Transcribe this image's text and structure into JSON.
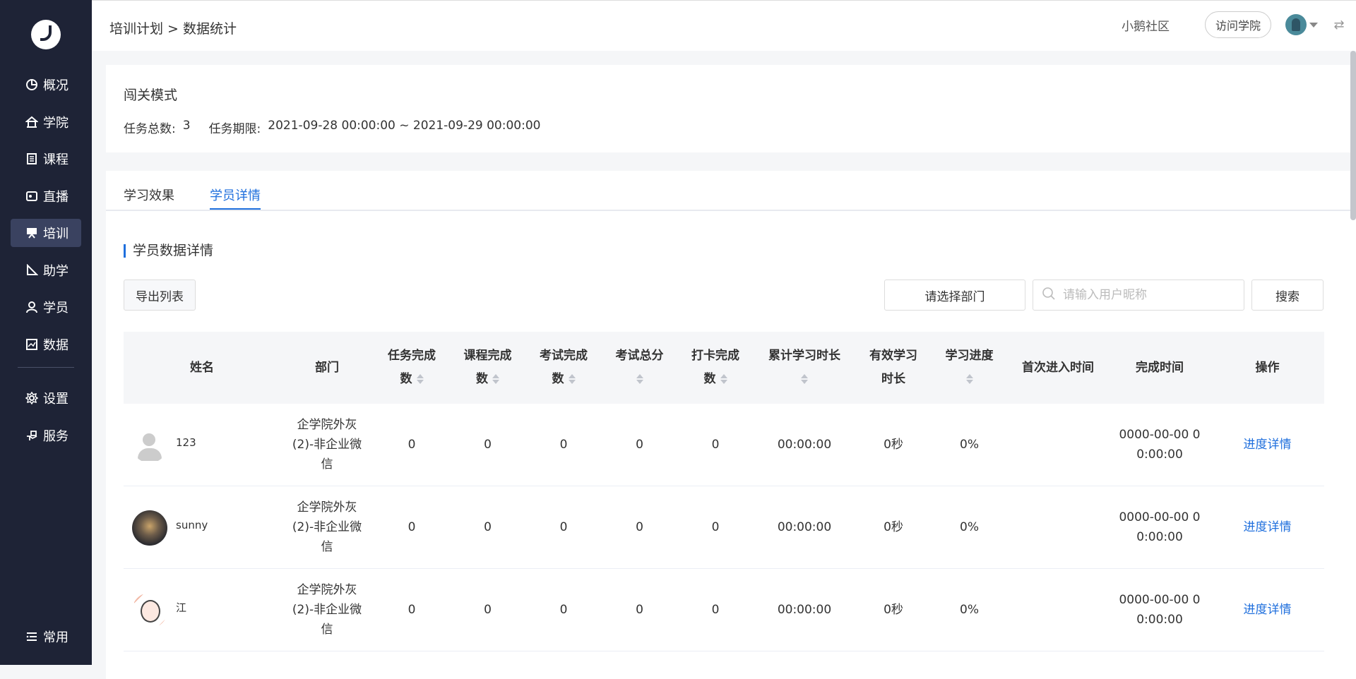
{
  "sidebar": {
    "items": [
      {
        "label": "概况",
        "icon": "pie-chart-icon"
      },
      {
        "label": "学院",
        "icon": "college-icon"
      },
      {
        "label": "课程",
        "icon": "book-icon"
      },
      {
        "label": "直播",
        "icon": "live-icon"
      },
      {
        "label": "培训",
        "icon": "training-icon",
        "active": true
      },
      {
        "label": "助学",
        "icon": "ruler-icon"
      },
      {
        "label": "学员",
        "icon": "user-icon"
      },
      {
        "label": "数据",
        "icon": "data-icon"
      },
      {
        "label": "设置",
        "icon": "gear-icon"
      },
      {
        "label": "服务",
        "icon": "service-icon"
      }
    ],
    "bottom": {
      "label": "常用",
      "icon": "list-icon"
    }
  },
  "header": {
    "breadcrumb": "培训计划 > 数据统计",
    "community": "小鹅社区",
    "visit": "访问学院"
  },
  "summary": {
    "title": "闯关模式",
    "total_label": "任务总数:",
    "total_value": "3",
    "period_label": "任务期限:",
    "period_value": "2021-09-28 00:00:00 ~ 2021-09-29 00:00:00"
  },
  "tabs": [
    "学习效果",
    "学员详情"
  ],
  "section_title": "学员数据详情",
  "toolbar": {
    "export": "导出列表",
    "dept": "请选择部门",
    "search_placeholder": "请输入用户昵称",
    "search": "搜索"
  },
  "table": {
    "headers": [
      "姓名",
      "部门",
      "任务完成",
      "数",
      "课程完成",
      "数",
      "考试完成",
      "数",
      "考试总分",
      "打卡完成",
      "数",
      "累计学习时长",
      "有效学习",
      "时长",
      "学习进度",
      "首次进入时间",
      "完成时间",
      "操作"
    ],
    "rows": [
      {
        "name": "123",
        "dept1": "企学院外灰",
        "dept2": "(2)-非企业微",
        "dept3": "信",
        "task": "0",
        "course": "0",
        "exam": "0",
        "score": "0",
        "checkin": "0",
        "total_time": "00:00:00",
        "effective": "0秒",
        "progress": "0%",
        "first": "",
        "finish1": "0000-00-00 0",
        "finish2": "0:00:00",
        "action": "进度详情"
      },
      {
        "name": "sunny",
        "dept1": "企学院外灰",
        "dept2": "(2)-非企业微",
        "dept3": "信",
        "task": "0",
        "course": "0",
        "exam": "0",
        "score": "0",
        "checkin": "0",
        "total_time": "00:00:00",
        "effective": "0秒",
        "progress": "0%",
        "first": "",
        "finish1": "0000-00-00 0",
        "finish2": "0:00:00",
        "action": "进度详情"
      },
      {
        "name": "江",
        "dept1": "企学院外灰",
        "dept2": "(2)-非企业微",
        "dept3": "信",
        "task": "0",
        "course": "0",
        "exam": "0",
        "score": "0",
        "checkin": "0",
        "total_time": "00:00:00",
        "effective": "0秒",
        "progress": "0%",
        "first": "",
        "finish1": "0000-00-00 0",
        "finish2": "0:00:00",
        "action": "进度详情"
      }
    ]
  },
  "colors": {
    "accent": "#1f6fdd",
    "sidebar_bg": "#1e2336",
    "active_bg": "#3a4260"
  }
}
